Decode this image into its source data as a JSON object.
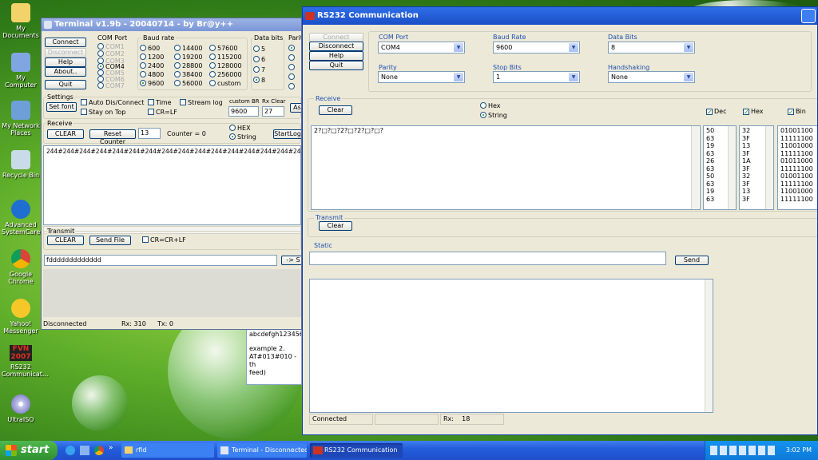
{
  "desktop": {
    "icons": [
      {
        "label": "My Documents"
      },
      {
        "label": "My Computer"
      },
      {
        "label": "My Network Places"
      },
      {
        "label": "Recycle Bin"
      },
      {
        "label": "Advanced SystemCare"
      },
      {
        "label": "Google Chrome"
      },
      {
        "label": "Yahoo! Messenger"
      },
      {
        "label": "RS232 Communicat..."
      },
      {
        "label": "UltraISO"
      }
    ],
    "fvn_logo": "FVN 2007",
    "notepad_lines": [
      "abcdefgh123456",
      "example 2.",
      "AT#013#010 - th",
      "feed)"
    ]
  },
  "terminal": {
    "title": "Terminal v1.9b - 20040714 - by Br@y++",
    "buttons": {
      "connect": "Connect",
      "disconnect": "Disconnect",
      "help": "Help",
      "about": "About..",
      "quit": "Quit"
    },
    "com_port": {
      "label": "COM Port",
      "options": [
        "COM1",
        "COM2",
        "COM3",
        "COM4",
        "COM5",
        "COM6",
        "COM7"
      ],
      "selected": "COM4"
    },
    "baud_rate": {
      "label": "Baud rate",
      "col1": [
        "600",
        "1200",
        "2400",
        "4800",
        "9600"
      ],
      "col2": [
        "14400",
        "19200",
        "28800",
        "38400",
        "56000"
      ],
      "col3": [
        "57600",
        "115200",
        "128000",
        "256000",
        "custom"
      ],
      "selected": "9600"
    },
    "data_bits": {
      "label": "Data bits",
      "options": [
        "5",
        "6",
        "7",
        "8"
      ],
      "selected": "8"
    },
    "parity_label": "Parit",
    "settings": {
      "label": "Settings",
      "set_font": "Set font",
      "auto_dis": "Auto Dis/Connect",
      "time": "Time",
      "stream_log": "Stream log",
      "stay_on_top": "Stay on Top",
      "cr_lf": "CR=LF",
      "custom_br_label": "custom BR",
      "custom_br_value": "9600",
      "rx_clear_label": "Rx Clear",
      "rx_clear_value": "27"
    },
    "receive": {
      "label": "Receive",
      "clear": "CLEAR",
      "reset_counter": "Reset Counter",
      "counter_spin": "13",
      "counter_text": "Counter = 0",
      "hex": "HEX",
      "string": "String",
      "start_log": "StartLog",
      "content": "244#244#244#244#244#244#244#244#244#244#244#244#244#244#244#244#244#244#2"
    },
    "transmit": {
      "label": "Transmit",
      "clear": "CLEAR",
      "send_file": "Send File",
      "cr_crlf": "CR=CR+LF",
      "input_value": "fddddddddddddd",
      "send": "-> S"
    },
    "status": {
      "state": "Disconnected",
      "rx": "Rx: 310",
      "tx": "Tx: 0"
    }
  },
  "rs232": {
    "title": "RS232 Communication",
    "buttons": {
      "connect": "Connect",
      "disconnect": "Disconnect",
      "help": "Help",
      "quit": "Quit"
    },
    "com_port": {
      "label": "COM Port",
      "value": "COM4"
    },
    "baud_rate": {
      "label": "Baud Rate",
      "value": "9600"
    },
    "data_bits": {
      "label": "Data Bits",
      "value": "8"
    },
    "parity": {
      "label": "Parity",
      "value": "None"
    },
    "stop_bits": {
      "label": "Stop Bits",
      "value": "1"
    },
    "handshaking": {
      "label": "Handshaking",
      "value": "None"
    },
    "receive": {
      "label": "Receive",
      "clear": "Clear",
      "hex": "Hex",
      "string": "String",
      "dec_label": "Dec",
      "hex_label": "Hex",
      "bin_label": "Bin",
      "content": "2?□?□?2?□?2?□?□?"
    },
    "dec_values": [
      "50",
      "63",
      "19",
      "63",
      "26",
      "63",
      "50",
      "63",
      "19",
      "63"
    ],
    "hex_values": [
      "32",
      "3F",
      "13",
      "3F",
      "1A",
      "3F",
      "32",
      "3F",
      "13",
      "3F"
    ],
    "bin_values": [
      "01001100",
      "11111100",
      "11001000",
      "11111100",
      "01011000",
      "11111100",
      "01001100",
      "11111100",
      "11001000",
      "11111100"
    ],
    "transmit": {
      "label": "Transmit",
      "clear": "Clear"
    },
    "static": {
      "label": "Static",
      "send": "Send"
    },
    "status": {
      "state": "Connected",
      "rx_label": "Rx:",
      "rx_value": "18"
    }
  },
  "taskbar": {
    "start": "start",
    "items": [
      {
        "label": "rfid"
      },
      {
        "label": "Terminal - Disconnected"
      },
      {
        "label": "RS232 Communication"
      }
    ],
    "clock": "3:02 PM"
  }
}
